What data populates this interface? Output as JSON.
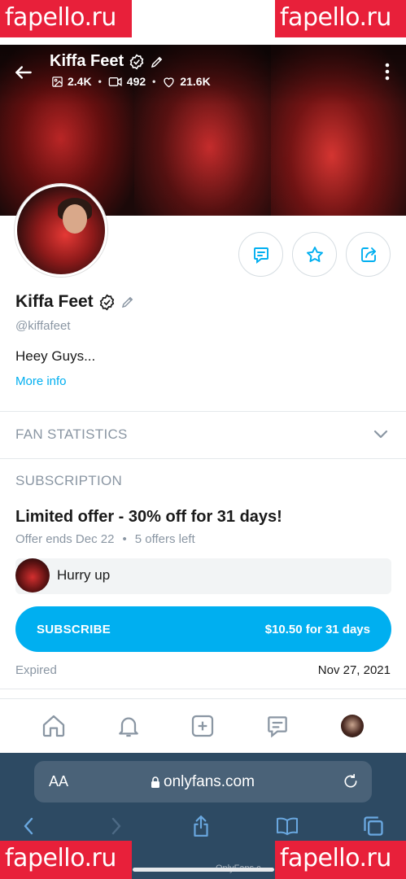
{
  "watermark": {
    "text": "fapello.ru",
    "color": "#e8203a"
  },
  "header": {
    "name": "Kiffa Feet",
    "stats": {
      "photos": "2.4K",
      "videos": "492",
      "likes": "21.6K"
    },
    "icons": {
      "back": "arrow-left-icon",
      "verified": "verified-badge-icon",
      "edit": "pencil-icon",
      "more": "vertical-dots-icon"
    }
  },
  "profile": {
    "name": "Kiffa Feet",
    "handle": "@kiffafeet",
    "bio": "Heey Guys...",
    "more_info": "More info",
    "actions": [
      "message-icon",
      "star-icon",
      "share-icon"
    ]
  },
  "fan_statistics": {
    "label": "FAN STATISTICS"
  },
  "subscription": {
    "section_label": "SUBSCRIPTION",
    "offer_title": "Limited offer - 30% off for 31 days!",
    "offer_ends": "Offer ends Dec 22",
    "offers_left": "5 offers left",
    "hurry_text": "Hurry up",
    "subscribe_label": "SUBSCRIBE",
    "subscribe_price": "$10.50 for 31 days",
    "expired_label": "Expired",
    "expired_date": "Nov 27, 2021"
  },
  "bottom_nav": [
    "home-icon",
    "bell-icon",
    "plus-square-icon",
    "message-icon",
    "avatar"
  ],
  "browser": {
    "aa_label": "AA",
    "url": "onlyfans.com",
    "footer_source": "OnlyFans.c"
  },
  "colors": {
    "accent": "#00aff0",
    "muted": "#8a96a3",
    "safari_bg": "#2d4a63"
  }
}
